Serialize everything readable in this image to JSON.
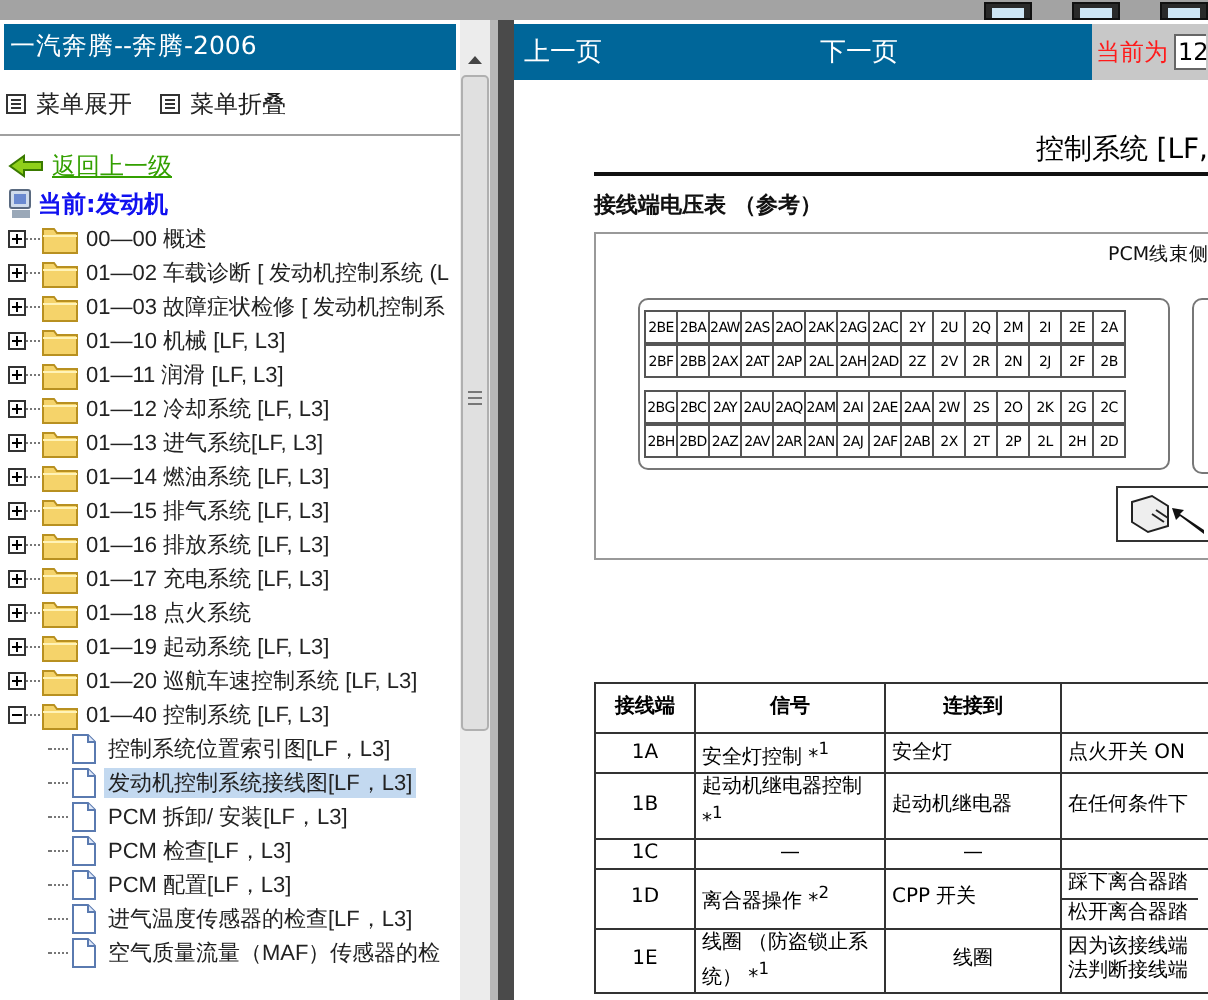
{
  "toolbar": {
    "buttons": [
      {
        "kind": "window"
      },
      {
        "kind": "window"
      },
      {
        "kind": "window"
      }
    ]
  },
  "left_panel": {
    "title": "一汽奔腾--奔腾-2006",
    "menu": [
      {
        "label": "菜单展开"
      },
      {
        "label": "菜单折叠"
      }
    ],
    "back_link": "返回上一级",
    "current": "当前:发动机",
    "tree": [
      {
        "label": "00—00 概述",
        "expanded": false
      },
      {
        "label": "01—02 车载诊断 [ 发动机控制系统 (L",
        "expanded": false
      },
      {
        "label": "01—03 故障症状检修 [ 发动机控制系",
        "expanded": false
      },
      {
        "label": "01—10 机械 [LF, L3]",
        "expanded": false
      },
      {
        "label": "01—11 润滑 [LF, L3]",
        "expanded": false
      },
      {
        "label": "01—12 冷却系统 [LF, L3]",
        "expanded": false
      },
      {
        "label": "01—13 进气系统[LF, L3]",
        "expanded": false
      },
      {
        "label": "01—14 燃油系统 [LF, L3]",
        "expanded": false
      },
      {
        "label": "01—15 排气系统 [LF, L3]",
        "expanded": false
      },
      {
        "label": "01—16 排放系统 [LF, L3]",
        "expanded": false
      },
      {
        "label": "01—17 充电系统 [LF, L3]",
        "expanded": false
      },
      {
        "label": "01—18 点火系统",
        "expanded": false
      },
      {
        "label": "01—19 起动系统 [LF, L3]",
        "expanded": false
      },
      {
        "label": "01—20 巡航车速控制系统 [LF, L3]",
        "expanded": false
      },
      {
        "label": "01—40 控制系统 [LF, L3]",
        "expanded": true,
        "children": [
          {
            "label": "控制系统位置索引图[LF，L3]",
            "selected": false
          },
          {
            "label": "发动机控制系统接线图[LF，L3]",
            "selected": true
          },
          {
            "label": "PCM 拆卸/ 安装[LF，L3]",
            "selected": false
          },
          {
            "label": "PCM 检查[LF，L3]",
            "selected": false
          },
          {
            "label": "PCM 配置[LF，L3]",
            "selected": false
          },
          {
            "label": "进气温度传感器的检查[LF，L3]",
            "selected": false
          },
          {
            "label": "空气质量流量（MAF）传感器的检",
            "selected": false
          }
        ]
      }
    ]
  },
  "right_panel": {
    "nav": {
      "prev": "上一页",
      "next": "下一页",
      "page_label": "当前为",
      "page_value": "12"
    },
    "document": {
      "title": "控制系统 [LF,",
      "section": "接线端电压表 （参考）",
      "diagram_caption": "PCM线束侧",
      "connector_rows": [
        [
          "2BE",
          "2BA",
          "2AW",
          "2AS",
          "2AO",
          "2AK",
          "2AG",
          "2AC",
          "2Y",
          "2U",
          "2Q",
          "2M",
          "2I",
          "2E",
          "2A"
        ],
        [
          "2BF",
          "2BB",
          "2AX",
          "2AT",
          "2AP",
          "2AL",
          "2AH",
          "2AD",
          "2Z",
          "2V",
          "2R",
          "2N",
          "2J",
          "2F",
          "2B"
        ],
        [
          "2BG",
          "2BC",
          "2AY",
          "2AU",
          "2AQ",
          "2AM",
          "2AI",
          "2AE",
          "2AA",
          "2W",
          "2S",
          "2O",
          "2K",
          "2G",
          "2C"
        ],
        [
          "2BH",
          "2BD",
          "2AZ",
          "2AV",
          "2AR",
          "2AN",
          "2AJ",
          "2AF",
          "2AB",
          "2X",
          "2T",
          "2P",
          "2L",
          "2H",
          "2D"
        ]
      ],
      "table": {
        "columns": [
          "接线端",
          "信号",
          "连接到"
        ],
        "rows": [
          {
            "terminal": "1A",
            "signal": "安全灯控制 *$^{1}$",
            "connects_to": "安全灯",
            "column_4": [
              "点火开关 ON"
            ]
          },
          {
            "terminal": "1B",
            "signal": "起动机继电器控制 *$^{1}$",
            "connects_to": "起动机继电器",
            "column_4": [
              "在任何条件下"
            ]
          },
          {
            "terminal": "1C",
            "signal": "—",
            "connects_to": "—",
            "column_4": []
          },
          {
            "terminal": "1D",
            "signal": "离合器操作 *$^{2}$",
            "connects_to": "CPP 开关",
            "column_4": [
              "踩下离合器踏",
              "松开离合器踏"
            ]
          },
          {
            "terminal": "1E",
            "signal": "线圈 （防盗锁止系统） *$^{1}$",
            "connects_to": "线圈",
            "column_4": [
              "因为该接线端法判断接线端"
            ]
          }
        ]
      }
    }
  }
}
